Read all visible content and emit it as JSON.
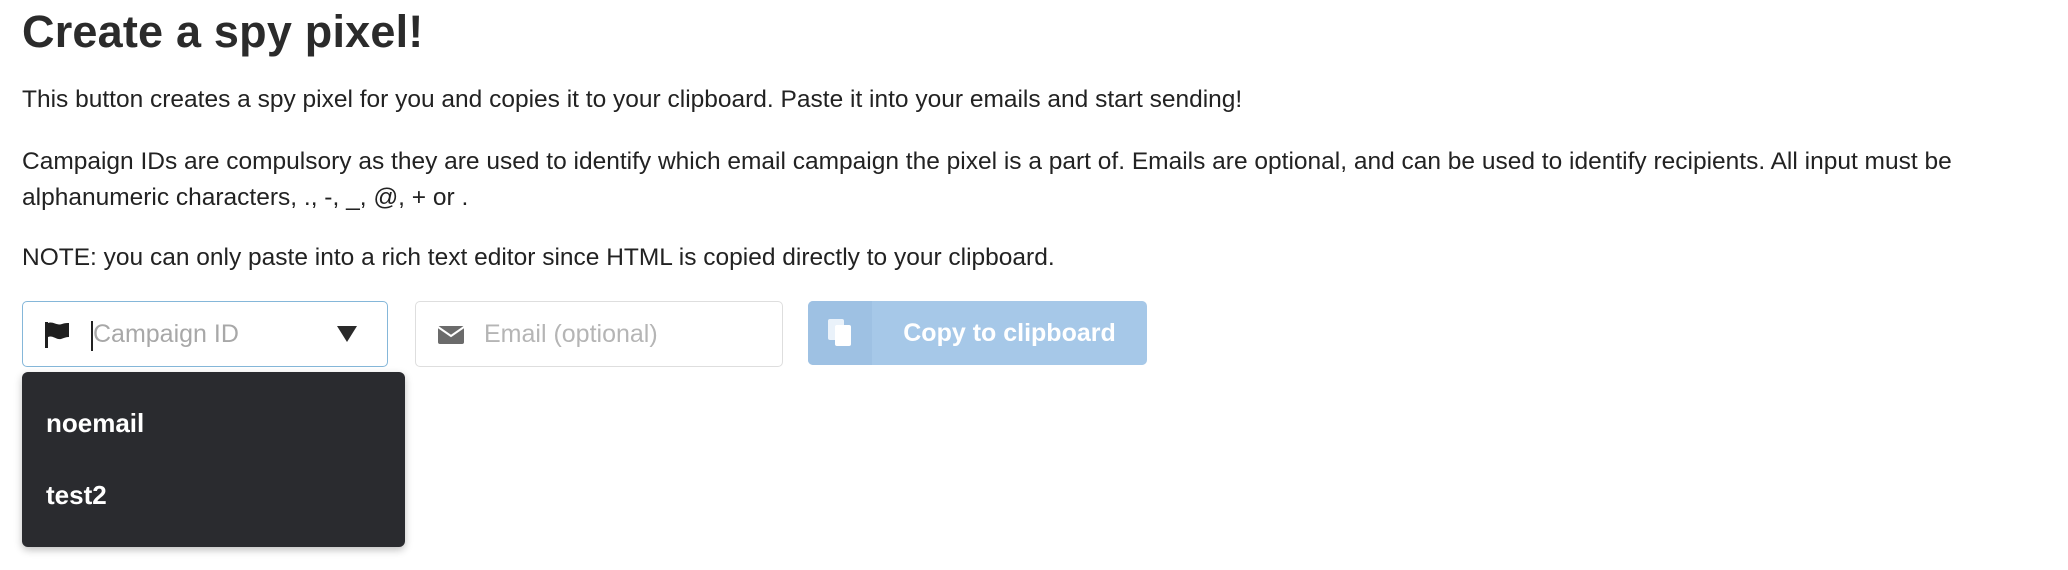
{
  "page": {
    "title": "Create a spy pixel!",
    "intro": "This button creates a spy pixel for you and copies it to your clipboard. Paste it into your emails and start sending!",
    "campaign_info": "Campaign IDs are compulsory as they are used to identify which email campaign the pixel is a part of. Emails are optional, and can be used to identify recipients. All input must be alphanumeric characters, ., -, _, @, + or .",
    "note": "NOTE: you can only paste into a rich text editor since HTML is copied directly to your clipboard."
  },
  "form": {
    "campaign": {
      "icon": "flag-icon",
      "placeholder": "Campaign ID",
      "value": "",
      "dropdown_icon": "triangle-down-icon",
      "options": [
        "noemail",
        "test2"
      ]
    },
    "email": {
      "icon": "envelope-icon",
      "placeholder": "Email (optional)",
      "value": ""
    },
    "copy_button": {
      "icon": "copy-icon",
      "label": "Copy to clipboard",
      "state": "disabled"
    }
  },
  "colors": {
    "text": "#222222",
    "focus_border": "#85b7d9",
    "button_bg": "#a6c8e8",
    "button_icon_bg": "#9ec1e3",
    "menu_bg": "#2a2b2f",
    "menu_text": "#ffffff"
  }
}
